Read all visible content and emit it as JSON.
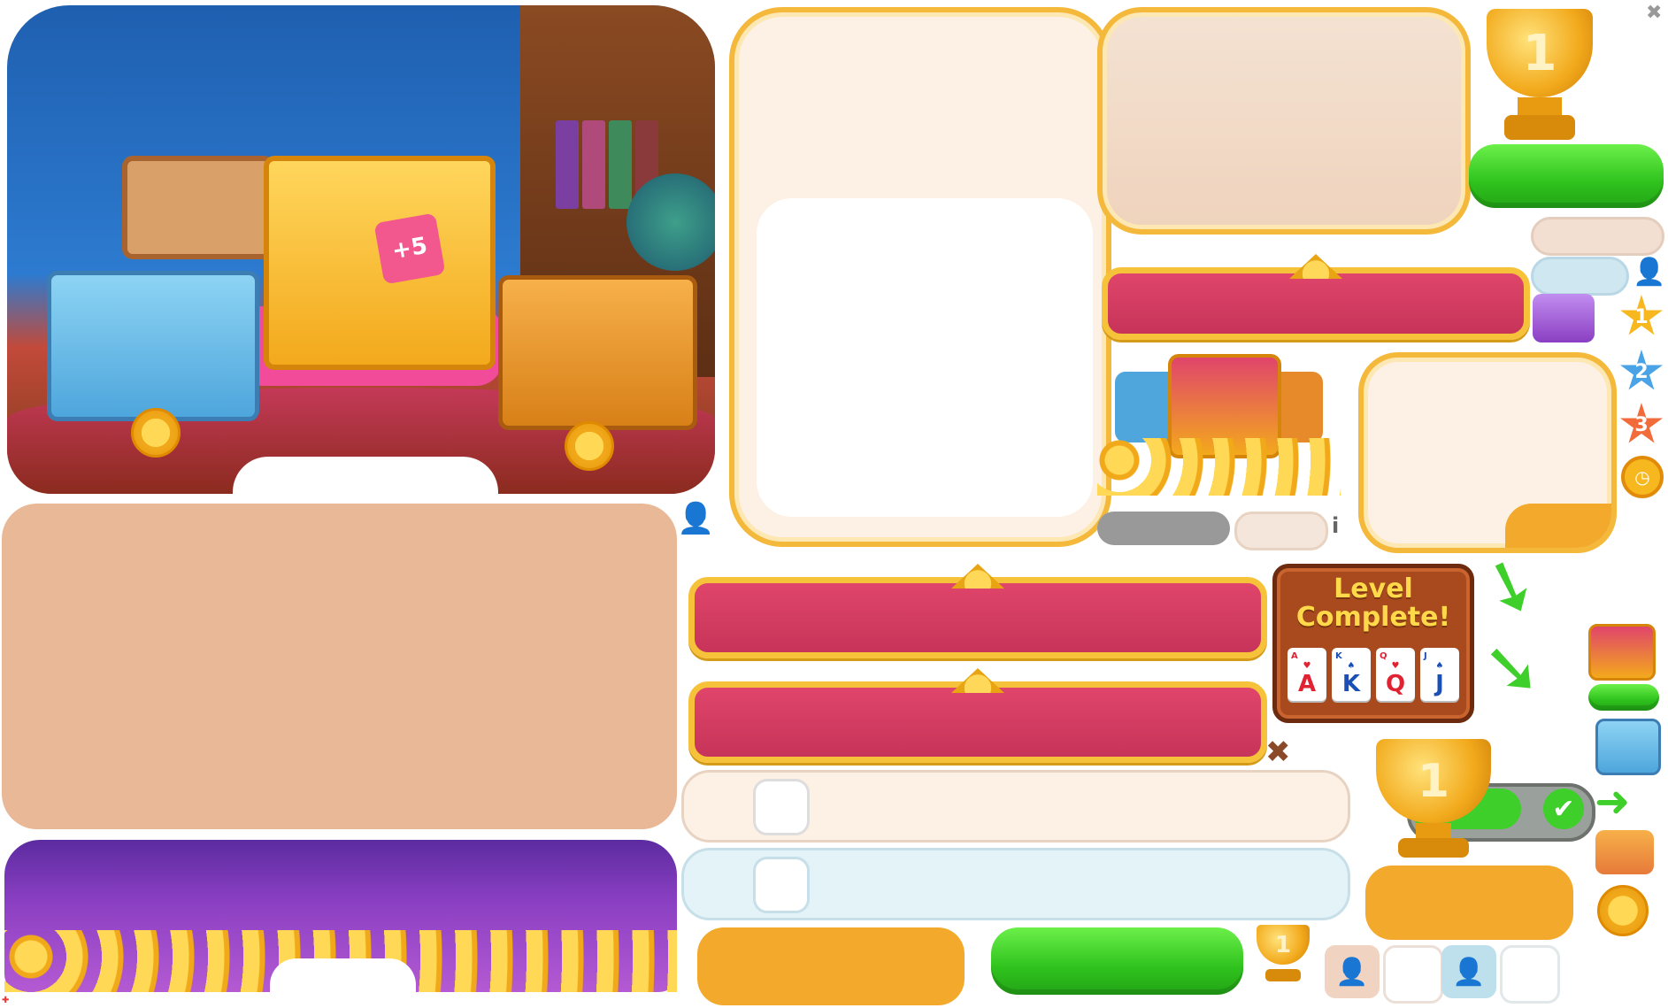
{
  "scene": {
    "badge": "+5"
  },
  "level_card": {
    "title_line1": "Level",
    "title_line2": "Complete!",
    "cards": [
      {
        "corner": "A",
        "rank": "A",
        "color": "#e02233",
        "suit": "♥"
      },
      {
        "corner": "K",
        "rank": "K",
        "color": "#1a4fb5",
        "suit": "♠"
      },
      {
        "corner": "Q",
        "rank": "Q",
        "color": "#e02233",
        "suit": "♥"
      },
      {
        "corner": "J",
        "rank": "J",
        "color": "#1a4fb5",
        "suit": "♠"
      }
    ]
  },
  "trophies": {
    "rank_large": "1",
    "rank_mid": "1",
    "rank_small": "1"
  },
  "stars": [
    "1",
    "2",
    "3"
  ],
  "info_glyph": "i",
  "colors": {
    "gold": "#f4b83a",
    "ribbon": "#d23d62",
    "green": "#36c521",
    "orange": "#f3a92c",
    "cream": "#fdf0e4",
    "tan": "#e8b897",
    "purple": "#8a3fc2",
    "star_gold": "#f7b81f",
    "star_blue": "#4aa3e6",
    "star_orange": "#f26b3b"
  },
  "icons": [
    "close-icon",
    "person-icon",
    "check-icon",
    "arrow-right-icon",
    "clock-icon",
    "heart-coin-icon",
    "info-icon",
    "chest-icon"
  ]
}
